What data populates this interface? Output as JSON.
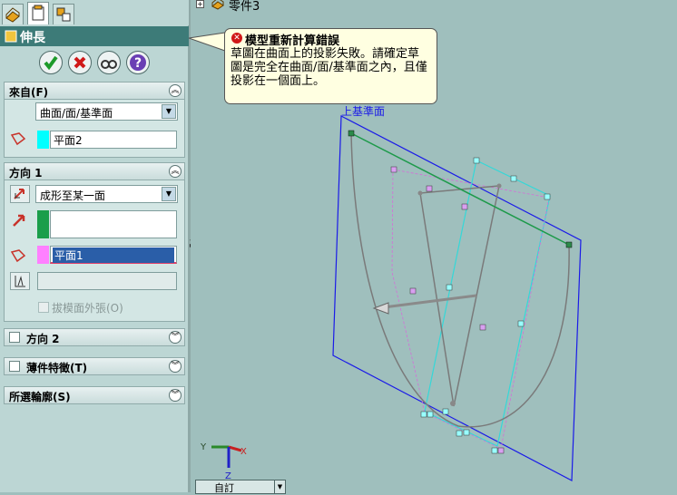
{
  "property_manager": {
    "tabs": [
      "feature-manager-icon",
      "property-manager-icon",
      "configuration-manager-icon"
    ],
    "feature_title": "伸長",
    "buttons": [
      "ok",
      "cancel",
      "detailed-preview",
      "help"
    ],
    "from_group": {
      "title": "來自(F)",
      "start_condition": "曲面/面/基準面",
      "selection": "平面2",
      "swatch_color": "#00ffff"
    },
    "direction1_group": {
      "title": "方向 1",
      "end_condition": "成形至某一面",
      "direction_field": "",
      "face_selection": "平面1",
      "selection_swatch_color": "#ff80ff",
      "direction_swatch_color": "#1a9e4a",
      "draft_label": "拔模面外張(O)"
    },
    "direction2_group": {
      "title": "方向 2"
    },
    "thin_feature_group": {
      "title": "薄件特徵(T)"
    },
    "selected_contours_group": {
      "title": "所選輪廓(S)"
    }
  },
  "viewport": {
    "tree_root": "零件3",
    "plane_label": "上基準面",
    "view_orientation": "自訂",
    "axis_labels": {
      "x": "X",
      "y": "Y",
      "z": "Z"
    },
    "error_balloon": {
      "title": "模型重新計算錯誤",
      "message": "草圖在曲面上的投影失敗。請確定草圖是完全在曲面/面/基準面之內，且僅投影在一個面上。"
    }
  }
}
